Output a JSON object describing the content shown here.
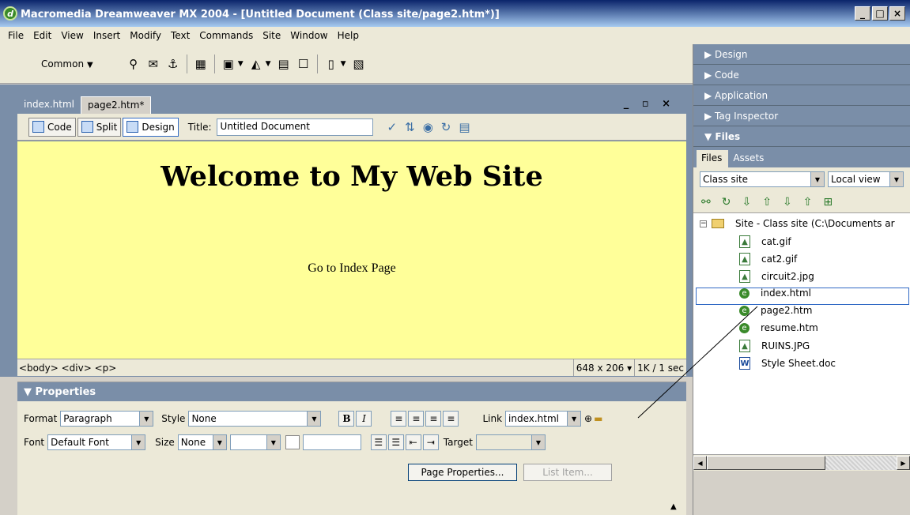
{
  "window": {
    "title": "Macromedia Dreamweaver MX 2004 - [Untitled Document (Class site/page2.htm*)]"
  },
  "menu": [
    "File",
    "Edit",
    "View",
    "Insert",
    "Modify",
    "Text",
    "Commands",
    "Site",
    "Window",
    "Help"
  ],
  "insert_bar": {
    "category": "Common"
  },
  "doc_tabs": [
    "index.html",
    "page2.htm*"
  ],
  "doc_toolbar": {
    "code_label": "Code",
    "split_label": "Split",
    "design_label": "Design",
    "title_label": "Title:",
    "title_value": "Untitled Document"
  },
  "design": {
    "heading": "Welcome to My Web Site",
    "link_text": "Go to Index Page"
  },
  "status": {
    "tag_selector": "<body> <div> <p>",
    "window_size": "648 x 206",
    "download_stats": "1K / 1 sec"
  },
  "properties": {
    "header": "Properties",
    "format_label": "Format",
    "format_value": "Paragraph",
    "style_label": "Style",
    "style_value": "None",
    "font_label": "Font",
    "font_value": "Default Font",
    "size_label": "Size",
    "size_value": "None",
    "link_label": "Link",
    "link_value": "index.html",
    "target_label": "Target",
    "bold_label": "B",
    "italic_label": "I",
    "page_properties_label": "Page Properties...",
    "list_item_label": "List Item..."
  },
  "panels": {
    "design": "Design",
    "code": "Code",
    "application": "Application",
    "tag_inspector": "Tag Inspector",
    "files": "Files"
  },
  "files_panel": {
    "tabs": [
      "Files",
      "Assets"
    ],
    "site_select": "Class site",
    "view_select": "Local view",
    "root": "Site - Class site (C:\\Documents ar",
    "items": [
      "cat.gif",
      "cat2.gif",
      "circuit2.jpg",
      "index.html",
      "page2.htm",
      "resume.htm",
      "RUINS.JPG",
      "Style Sheet.doc"
    ]
  }
}
